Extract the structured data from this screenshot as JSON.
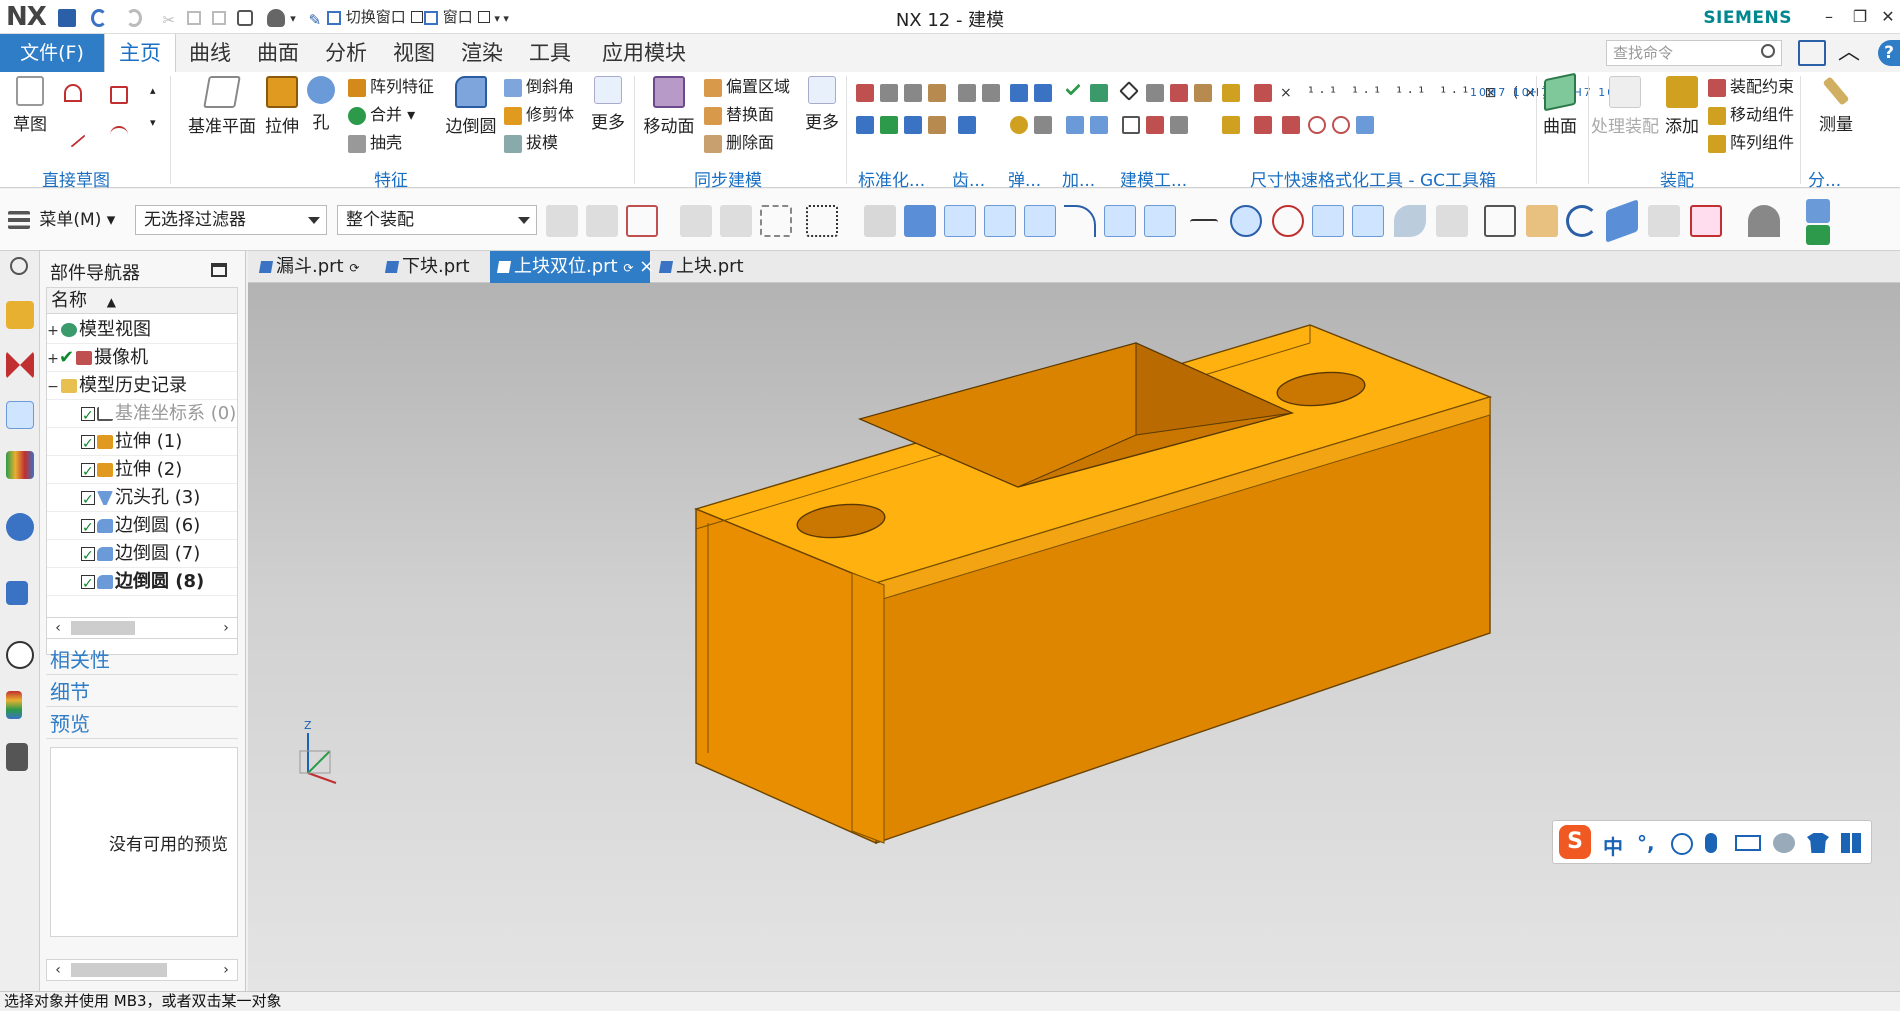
{
  "app": {
    "logo": "NX",
    "title": "NX 12 - 建模",
    "brand": "SIEMENS",
    "quick_access": {
      "switch_window": "切换窗口",
      "window": "窗口"
    },
    "window_controls": {
      "minimize": "–",
      "restore": "❐",
      "close": "✕"
    }
  },
  "menu": {
    "file": "文件(F)",
    "tabs": [
      "主页",
      "曲线",
      "曲面",
      "分析",
      "视图",
      "渲染",
      "工具",
      "应用模块"
    ],
    "active_tab": "主页",
    "search_placeholder": "查找命令"
  },
  "ribbon": {
    "sketch": {
      "label": "草图",
      "group": "直接草图"
    },
    "feature": {
      "group": "特征",
      "datum_plane": "基准平面",
      "extrude": "拉伸",
      "hole": "孔",
      "pattern": "阵列特征",
      "unite": "合并",
      "shell": "抽壳",
      "edge_blend": "边倒圆",
      "chamfer": "倒斜角",
      "trim_body": "修剪体",
      "draft": "拔模",
      "more": "更多"
    },
    "sync": {
      "group": "同步建模",
      "move_face": "移动面",
      "offset_region": "偏置区域",
      "replace_face": "替换面",
      "delete_face": "删除面",
      "more": "更多"
    },
    "groups": {
      "standard": "标准化...",
      "gear": "齿...",
      "spring": "弹...",
      "add": "加...",
      "modeling_tools": "建模工...",
      "dim_format": "尺寸快速格式化工具 - GC工具箱",
      "surface": "曲面",
      "assembly": "装配",
      "analysis": "分..."
    },
    "assembly": {
      "process": "处理装配",
      "add": "添加",
      "constraint": "装配约束",
      "move_component": "移动组件",
      "pattern_component": "阵列组件",
      "measure": "测量"
    }
  },
  "toolbar2": {
    "menu": "菜单(M)",
    "filter": "无选择过滤器",
    "scope": "整个装配"
  },
  "navigator": {
    "title": "部件导航器",
    "column_name": "名称",
    "tree": [
      {
        "label": "模型视图",
        "type": "folder-model",
        "style": "normal"
      },
      {
        "label": "摄像机",
        "type": "camera",
        "style": "normal"
      },
      {
        "label": "模型历史记录",
        "type": "folder",
        "style": "normal"
      },
      {
        "label": "基准坐标系 (0)",
        "type": "datum",
        "style": "gray"
      },
      {
        "label": "拉伸 (1)",
        "type": "extrude",
        "style": "normal"
      },
      {
        "label": "拉伸 (2)",
        "type": "extrude",
        "style": "normal"
      },
      {
        "label": "沉头孔 (3)",
        "type": "hole",
        "style": "normal"
      },
      {
        "label": "边倒圆 (6)",
        "type": "blend",
        "style": "normal"
      },
      {
        "label": "边倒圆 (7)",
        "type": "blend",
        "style": "normal"
      },
      {
        "label": "边倒圆 (8)",
        "type": "blend",
        "style": "bold"
      }
    ],
    "sections": [
      "相关性",
      "细节",
      "预览"
    ],
    "preview_text": "没有可用的预览"
  },
  "doc_tabs": [
    {
      "label": "漏斗.prt"
    },
    {
      "label": "下块.prt"
    },
    {
      "label": "上块双位.prt",
      "active": true
    },
    {
      "label": "上块.prt"
    }
  ],
  "viewport": {
    "model_color": "#f0a20f",
    "triad": {
      "z": "Z"
    }
  },
  "ime": {
    "lang": "中",
    "punct": "°,"
  },
  "status": "选择对象并使用 MB3，或者双击某一对象"
}
